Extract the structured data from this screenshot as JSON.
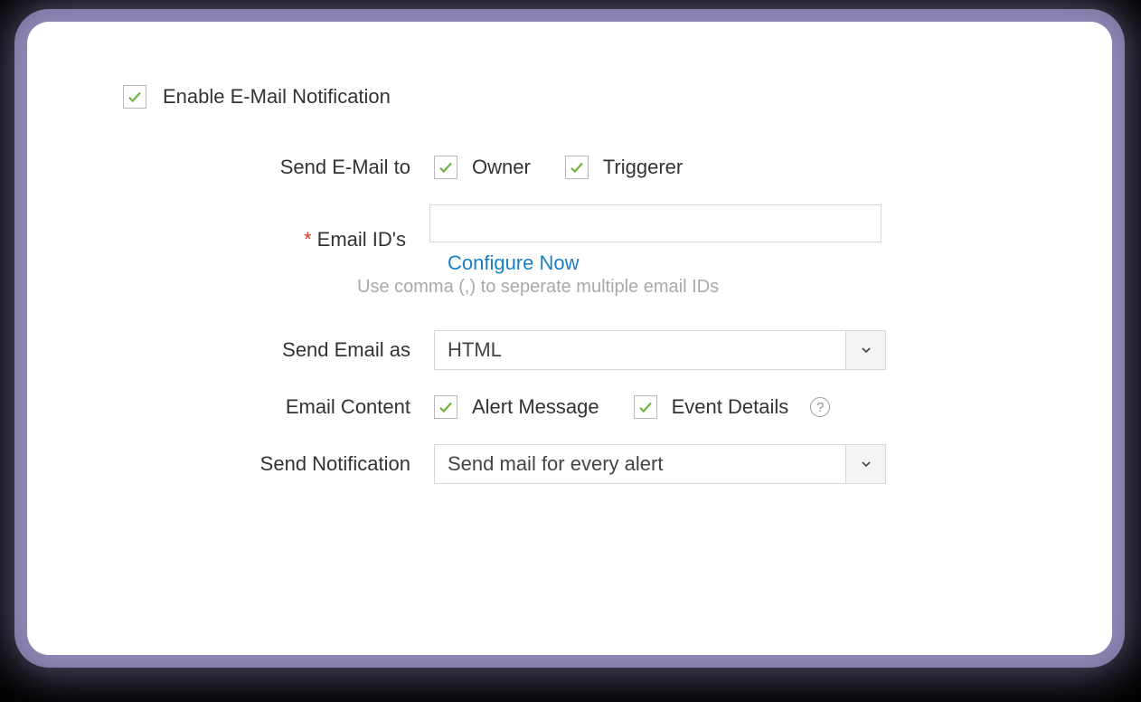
{
  "enable": {
    "label": "Enable E-Mail Notification",
    "checked": true
  },
  "send_to": {
    "label": "Send E-Mail to",
    "options": [
      {
        "label": "Owner",
        "checked": true
      },
      {
        "label": "Triggerer",
        "checked": true
      }
    ]
  },
  "email_ids": {
    "label": "Email ID's",
    "required_mark": "*",
    "value": "",
    "helper": "Use comma (,) to seperate multiple email IDs",
    "configure_link": "Configure Now"
  },
  "send_as": {
    "label": "Send Email as",
    "value": "HTML"
  },
  "content": {
    "label": "Email Content",
    "options": [
      {
        "label": "Alert Message",
        "checked": true
      },
      {
        "label": "Event Details",
        "checked": true
      }
    ],
    "help_glyph": "?"
  },
  "send_notification": {
    "label": "Send Notification",
    "value": "Send mail for every alert"
  }
}
